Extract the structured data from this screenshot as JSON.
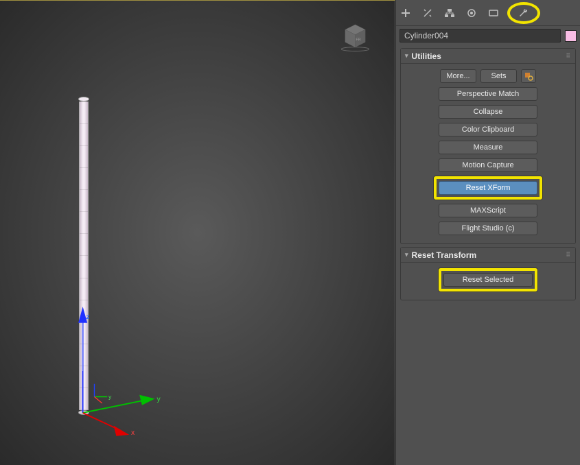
{
  "object_name": "Cylinder004",
  "swatch_color": "#f8bde4",
  "rollouts": {
    "utilities": {
      "title": "Utilities",
      "more": "More...",
      "sets": "Sets",
      "items": [
        "Perspective Match",
        "Collapse",
        "Color Clipboard",
        "Measure",
        "Motion Capture",
        "Reset XForm",
        "MAXScript",
        "Flight Studio (c)"
      ]
    },
    "reset_transform": {
      "title": "Reset Transform",
      "button": "Reset Selected"
    }
  }
}
